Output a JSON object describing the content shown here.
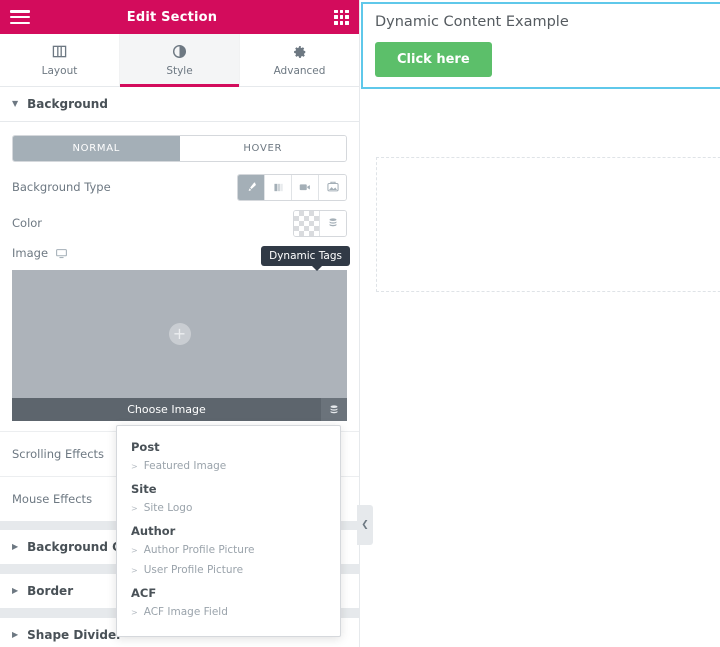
{
  "panel": {
    "header": {
      "title": "Edit Section",
      "menu_icon": "hamburger-icon",
      "grid_icon": "apps-grid-icon"
    },
    "tabs": [
      {
        "label": "Layout",
        "icon": "columns-icon",
        "active": false
      },
      {
        "label": "Style",
        "icon": "contrast-icon",
        "active": true
      },
      {
        "label": "Advanced",
        "icon": "gear-icon",
        "active": false
      }
    ],
    "sections": {
      "background": {
        "title": "Background",
        "expanded": true,
        "state_toggle": {
          "normal": "NORMAL",
          "hover": "HOVER",
          "active": "NORMAL"
        },
        "background_type": {
          "label": "Background Type",
          "options": [
            "classic",
            "gradient",
            "video",
            "slideshow"
          ],
          "selected": "classic"
        },
        "color": {
          "label": "Color",
          "value": "transparent",
          "dynamic_icon": "dynamic-tags-icon"
        },
        "image": {
          "label": "Image",
          "responsive_icon": "desktop-icon",
          "choose_label": "Choose Image",
          "placeholder_icon": "plus-icon",
          "dynamic_icon": "dynamic-tags-icon"
        },
        "scrolling_effects": "Scrolling Effects",
        "mouse_effects": "Mouse Effects"
      },
      "collapsed": [
        {
          "title": "Background Overlay"
        },
        {
          "title": "Border"
        },
        {
          "title": "Shape Divider"
        }
      ]
    }
  },
  "tooltip": {
    "text": "Dynamic Tags"
  },
  "dropdown": {
    "groups": [
      {
        "title": "Post",
        "items": [
          "Featured Image"
        ]
      },
      {
        "title": "Site",
        "items": [
          "Site Logo"
        ]
      },
      {
        "title": "Author",
        "items": [
          "Author Profile Picture",
          "User Profile Picture"
        ]
      },
      {
        "title": "ACF",
        "items": [
          "ACF Image Field"
        ]
      }
    ]
  },
  "preview": {
    "heading": "Dynamic Content Example",
    "button_label": "Click here",
    "accent_border": "#5fc8ea",
    "button_color": "#5cbf6a"
  },
  "collapse": {
    "icon": "chevron-left-icon"
  },
  "colors": {
    "brand": "#d30c5c",
    "panel_text": "#6d7882",
    "active_toggle": "#a4afb7",
    "media_bar": "#5d656d",
    "media_box": "#adb3ba"
  }
}
